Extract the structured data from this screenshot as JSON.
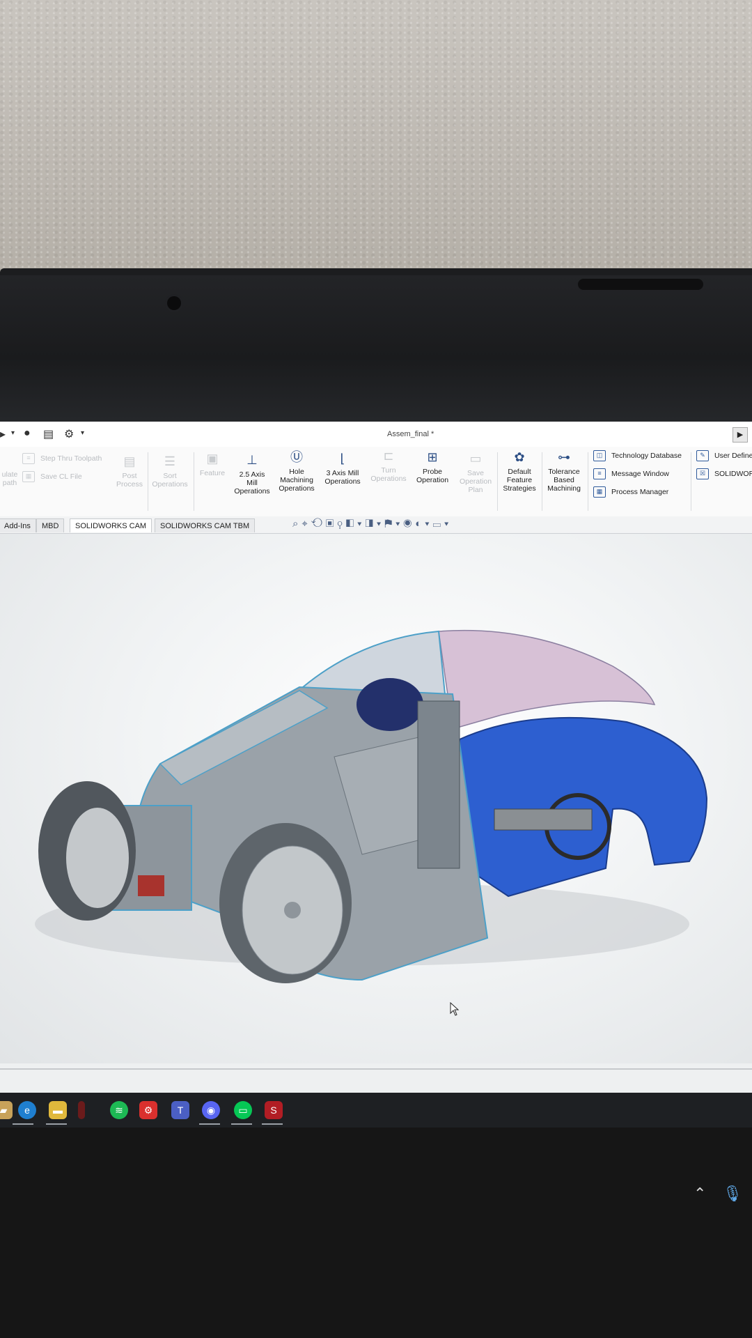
{
  "window": {
    "title": "Assem_final *"
  },
  "ribbon": {
    "step_thru_toolpath": "Step Thru Toolpath",
    "save_cl_file": "Save CL File",
    "simulate_toolpath": "ulate\npath",
    "post_process": "Post\nProcess",
    "sort_operations": "Sort\nOperations",
    "feature": "Feature",
    "axis25": "2.5 Axis\nMill\nOperations",
    "hole": "Hole\nMachining\nOperations",
    "axis3": "3 Axis Mill\nOperations",
    "turn": "Turn\nOperations",
    "probe": "Probe\nOperation",
    "save_plan": "Save\nOperation\nPlan",
    "default_feature": "Default\nFeature\nStrategies",
    "tolerance": "Tolerance\nBased\nMachining",
    "tech_db": "Technology Database",
    "msg_window": "Message Window",
    "process_mgr": "Process Manager",
    "user_defined": "User Define",
    "solidworks": "SOLIDWORK"
  },
  "tabs": [
    "Add-Ins",
    "MBD",
    "SOLIDWORKS CAM",
    "SOLIDWORKS CAM TBM"
  ],
  "taskbar": {
    "apps": [
      "file-explorer-icon",
      "edge-icon",
      "folder-icon",
      "app-icon",
      "spotify-icon",
      "settings-app-icon",
      "teams-icon",
      "discord-icon",
      "line-icon",
      "solidworks-app-icon"
    ]
  },
  "colors": {
    "body_blue": "#2d5fd0",
    "frame_grey": "#8f969d",
    "ribbon_icon": "#2d4f85"
  }
}
